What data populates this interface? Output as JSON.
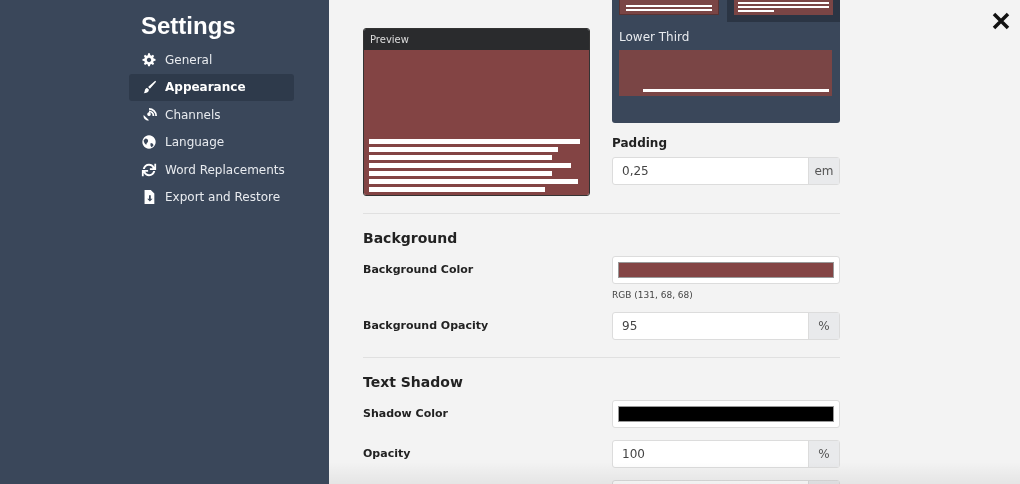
{
  "sidebar": {
    "title": "Settings",
    "items": [
      {
        "label": "General",
        "selected": false
      },
      {
        "label": "Appearance",
        "selected": true
      },
      {
        "label": "Channels",
        "selected": false
      },
      {
        "label": "Language",
        "selected": false
      },
      {
        "label": "Word Replacements",
        "selected": false
      },
      {
        "label": "Export and Restore",
        "selected": false
      }
    ]
  },
  "preview": {
    "title": "Preview"
  },
  "position_options": [
    {
      "selected": false
    },
    {
      "selected": true
    },
    {
      "label": "Lower Third",
      "selected": false
    }
  ],
  "padding": {
    "label": "Padding",
    "value": "0,25",
    "unit": "em"
  },
  "sections": [
    {
      "title": "Background",
      "fields": [
        {
          "kind": "color",
          "label": "Background Color",
          "color": "#834444",
          "caption": "RGB (131, 68, 68)"
        },
        {
          "kind": "number",
          "label": "Background Opacity",
          "value": "95",
          "unit": "%"
        }
      ]
    },
    {
      "title": "Text Shadow",
      "fields": [
        {
          "kind": "color",
          "label": "Shadow Color",
          "color": "#000000"
        },
        {
          "kind": "number",
          "label": "Opacity",
          "value": "100",
          "unit": "%"
        },
        {
          "kind": "partial"
        }
      ]
    }
  ]
}
